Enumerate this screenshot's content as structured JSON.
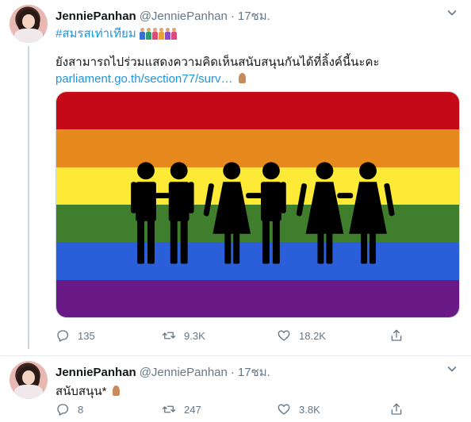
{
  "tweets": [
    {
      "author": {
        "name": "JenniePanhan",
        "handle": "@JenniePanhan",
        "time": "17ชม."
      },
      "hashtag": "#สมรสเท่าเทียม",
      "text": "ยังสามารถไปร่วมแสดงความคิดเห็นสนับสนุนกันได้ที่ลิ้งค์นี้นะคะ ",
      "link": "parliament.go.th/section77/surv…",
      "image": {
        "description_icon": "rainbow-flag-couples-icon",
        "stripes": [
          "#c30a16",
          "#e8891e",
          "#fdea37",
          "#3f7e2d",
          "#2b5fd9",
          "#6a1a86"
        ]
      },
      "stats": {
        "replies": "135",
        "retweets": "9.3K",
        "likes": "18.2K"
      }
    },
    {
      "author": {
        "name": "JenniePanhan",
        "handle": "@JenniePanhan",
        "time": "17ชม."
      },
      "text": "สนับสนุน*",
      "stats": {
        "replies": "8",
        "retweets": "247",
        "likes": "3.8K"
      }
    }
  ],
  "icons": {
    "reply": "reply-icon",
    "retweet": "retweet-icon",
    "like": "heart-icon",
    "share": "share-icon",
    "caret": "chevron-down-icon"
  },
  "colors": {
    "link": "#1b95e0",
    "muted": "#657786",
    "text": "#14171a"
  }
}
